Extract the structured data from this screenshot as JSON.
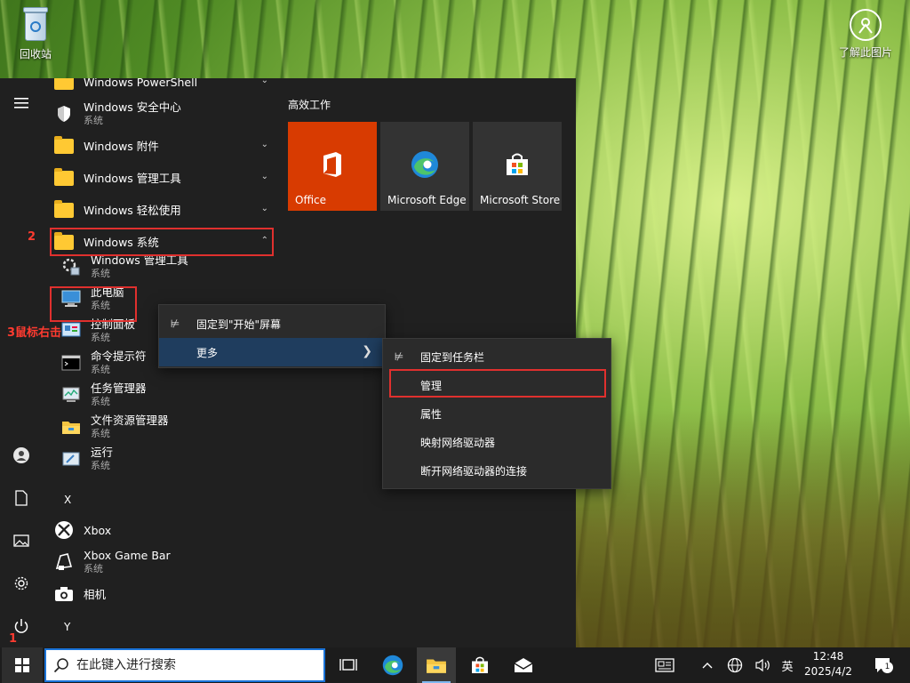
{
  "desktop": {
    "recycle_bin_label": "回收站",
    "learn_picture_label": "了解此图片"
  },
  "start_menu": {
    "apps": [
      {
        "name": "Windows PowerShell",
        "kind": "folder"
      },
      {
        "name": "Windows 安全中心",
        "sub": "系统"
      },
      {
        "name": "Windows 附件",
        "kind": "folder"
      },
      {
        "name": "Windows 管理工具",
        "kind": "folder"
      },
      {
        "name": "Windows 轻松使用",
        "kind": "folder"
      },
      {
        "name": "Windows 系统",
        "kind": "folder",
        "expanded": true
      }
    ],
    "system_items": [
      {
        "name": "Windows 管理工具",
        "sub": "系统"
      },
      {
        "name": "此电脑",
        "sub": "系统"
      },
      {
        "name": "控制面板",
        "sub": "系统"
      },
      {
        "name": "命令提示符",
        "sub": "系统"
      },
      {
        "name": "任务管理器",
        "sub": "系统"
      },
      {
        "name": "文件资源管理器",
        "sub": "系统"
      },
      {
        "name": "运行",
        "sub": "系统"
      }
    ],
    "letter_x": "X",
    "x_apps": [
      {
        "name": "Xbox"
      },
      {
        "name": "Xbox Game Bar",
        "sub": "系统"
      },
      {
        "name": "相机"
      }
    ],
    "letter_y": "Y",
    "tiles_group_title": "高效工作",
    "tiles": [
      {
        "label": "Office",
        "bg": "#d83b01"
      },
      {
        "label": "Microsoft Edge",
        "bg": "#333333"
      },
      {
        "label": "Microsoft Store",
        "bg": "#333333"
      }
    ]
  },
  "context_menu_1": {
    "pin_start": "固定到\"开始\"屏幕",
    "more": "更多"
  },
  "context_menu_2": {
    "pin_taskbar": "固定到任务栏",
    "manage": "管理",
    "properties": "属性",
    "map_drive": "映射网络驱动器",
    "disconnect_drive": "断开网络驱动器的连接"
  },
  "annotations": {
    "step1": "1",
    "step2": "2",
    "step3": "3鼠标右击"
  },
  "taskbar": {
    "search_placeholder": "在此键入进行搜索",
    "ime": "英",
    "time": "12:48",
    "date": "2025/4/2",
    "notification_count": "1"
  },
  "colors": {
    "accent_annotation": "#e0302e",
    "office_tile": "#d83b01",
    "menu_bg": "#202020",
    "highlight": "#1f3d5e"
  }
}
